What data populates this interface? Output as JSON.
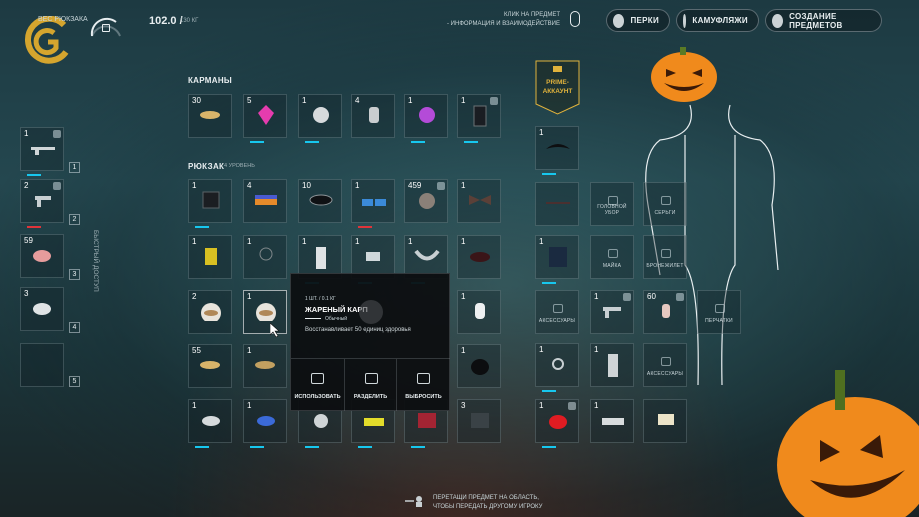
{
  "top": {
    "backpack_weight_label": "ВЕС РЮКЗАКА",
    "weight_value": "102.0 /",
    "weight_max": "130 КГ",
    "hint_line1": "КЛИК НА ПРЕДМЕТ",
    "hint_line2": "- ИНФОРМАЦИЯ И ВЗАИМОДЕЙСТВИЕ",
    "buttons": [
      {
        "label": "ПЕРКИ"
      },
      {
        "label": "КАМУФЛЯЖИ"
      },
      {
        "label": "СОЗДАНИЕ ПРЕДМЕТОВ"
      }
    ]
  },
  "quick_access": {
    "label": "БЫСТРЫЙ ДОСТУП",
    "slots": [
      {
        "qty": "1",
        "num": "1"
      },
      {
        "qty": "2",
        "num": "2"
      },
      {
        "qty": "59",
        "num": "3"
      },
      {
        "qty": "3",
        "num": "4"
      },
      {
        "qty": "",
        "num": "5"
      }
    ]
  },
  "pockets": {
    "title": "КАРМАНЫ",
    "items": [
      "30",
      "5",
      "1",
      "4",
      "1",
      "1"
    ]
  },
  "backpack": {
    "title": "РЮКЗАК",
    "level": "4 УРОВЕНЬ",
    "rows": [
      [
        "1",
        "4",
        "10",
        "1",
        "459",
        "1"
      ],
      [
        "1",
        "1",
        "1",
        "1",
        "1",
        "1"
      ],
      [
        "2",
        "1",
        "",
        "",
        "",
        "1"
      ],
      [
        "55",
        "1",
        "",
        "",
        "",
        "1"
      ],
      [
        "1",
        "1",
        "",
        "",
        "",
        "3"
      ]
    ]
  },
  "popup": {
    "meta": "1 ШТ. / 0.1 КГ",
    "name": "ЖАРЕНЫЙ КАРП",
    "rarity": "Обычный",
    "description": "Восстанавливает 50 единиц здоровья",
    "actions": [
      "ИСПОЛЬЗОВАТЬ",
      "РАЗДЕЛИТЬ",
      "ВЫБРОСИТЬ"
    ]
  },
  "prime": {
    "line1": "PRIME-",
    "line2": "АККАУНТ"
  },
  "equipment": {
    "headwear": "ГОЛОВНОЙ УБОР",
    "earrings": "СЕРЬГИ",
    "shirt": "МАЙКА",
    "armor": "БРОНЕЖИЛЕТ",
    "accessories": "АКСЕССУАРЫ",
    "gloves": "ПЕРЧАТКИ",
    "accessories2": "АКСЕССУАРЫ",
    "qty_mask": "1",
    "qty_top1": "1",
    "qty_jacket": "1",
    "qty_pistol": "1",
    "qty_wrist": "60",
    "qty_watch": "1",
    "qty_pants": "1",
    "qty_cap": "1",
    "qty_shoes": "1"
  },
  "bottom_hint": {
    "line1": "ПЕРЕТАЩИ ПРЕДМЕТ НА ОБЛАСТЬ,",
    "line2": "ЧТОБЫ ПЕРЕДАТЬ ДРУГОМУ ИГРОКУ"
  },
  "colors": {
    "accent": "#17c7ee",
    "danger": "#e0343a",
    "gold": "#e0b23c"
  }
}
